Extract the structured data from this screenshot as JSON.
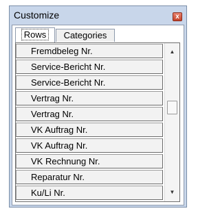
{
  "window": {
    "title": "Customize",
    "close_label": "x"
  },
  "tabs": [
    {
      "label": "Rows",
      "selected": true
    },
    {
      "label": "Categories",
      "selected": false
    }
  ],
  "list": {
    "items": [
      "Fremdbeleg Nr.",
      "Service-Bericht Nr.",
      "Service-Bericht Nr.",
      "Vertrag Nr.",
      "Vertrag Nr.",
      "VK Auftrag Nr.",
      "VK Auftrag Nr.",
      "VK Rechnung Nr.",
      "Reparatur Nr.",
      "Ku/Li Nr."
    ]
  },
  "scrollbar": {
    "up_icon": "arrow-up",
    "down_icon": "arrow-down"
  }
}
